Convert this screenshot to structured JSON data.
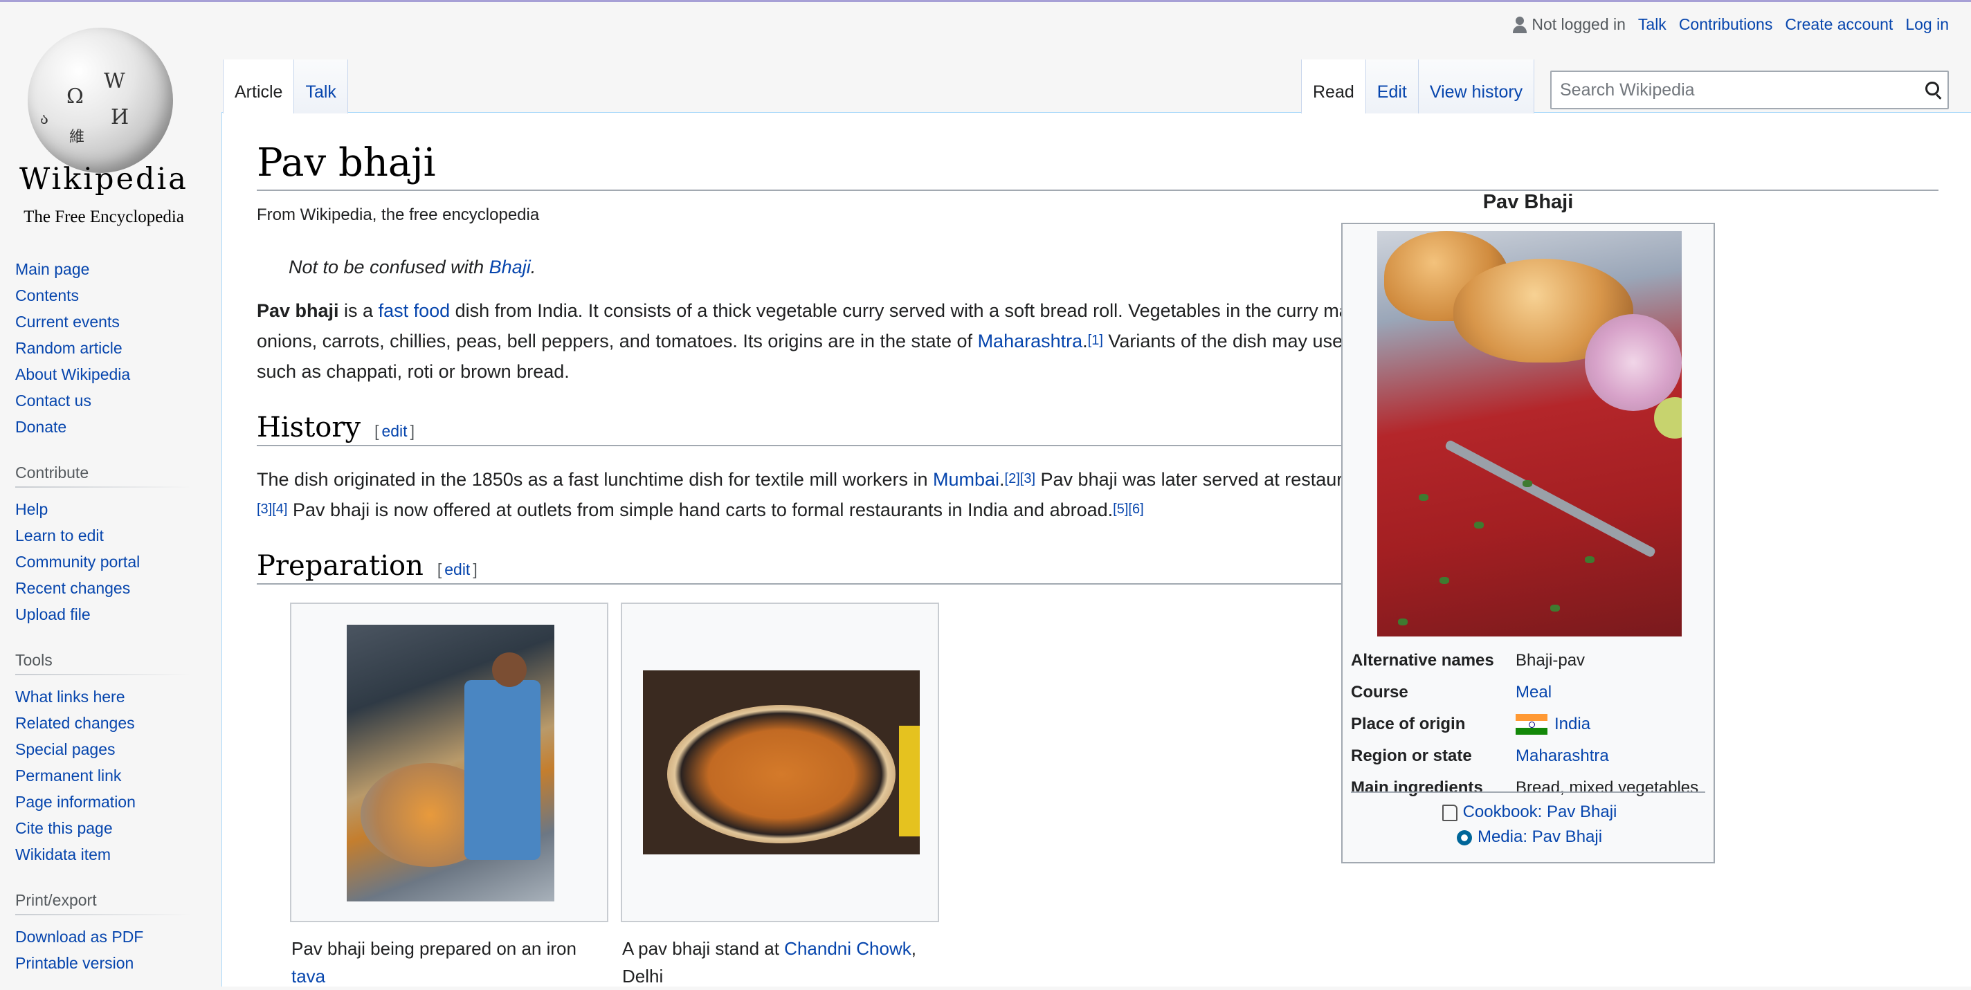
{
  "logo": {
    "wordmark": "Wikipedia",
    "tagline": "The Free Encyclopedia"
  },
  "sidebar": {
    "navigation": [
      "Main page",
      "Contents",
      "Current events",
      "Random article",
      "About Wikipedia",
      "Contact us",
      "Donate"
    ],
    "contribute_heading": "Contribute",
    "contribute": [
      "Help",
      "Learn to edit",
      "Community portal",
      "Recent changes",
      "Upload file"
    ],
    "tools_heading": "Tools",
    "tools": [
      "What links here",
      "Related changes",
      "Special pages",
      "Permanent link",
      "Page information",
      "Cite this page",
      "Wikidata item"
    ],
    "print_heading": "Print/export",
    "print": [
      "Download as PDF",
      "Printable version"
    ]
  },
  "personal": {
    "status": "Not logged in",
    "talk": "Talk",
    "contributions": "Contributions",
    "create_account": "Create account",
    "login": "Log in"
  },
  "tabs": {
    "article": "Article",
    "talk": "Talk",
    "read": "Read",
    "edit": "Edit",
    "history": "View history"
  },
  "search": {
    "placeholder": "Search Wikipedia"
  },
  "article": {
    "title": "Pav bhaji",
    "site_sub": "From Wikipedia, the free encyclopedia",
    "hatnote_prefix": "Not to be confused with ",
    "hatnote_link": "Bhaji",
    "hatnote_suffix": ".",
    "intro": {
      "bold": "Pav bhaji",
      "t1": " is a ",
      "link1": "fast food",
      "t2": " dish from India. It consists of a thick vegetable curry served with a soft bread roll. Vegetables in the curry may include potatoes, onions, carrots, chillies, peas, bell peppers, and tomatoes. Its origins are in the state of ",
      "link2": "Maharashtra",
      "t3": ".",
      "ref1": "[1]",
      "t4": " Variants of the dish may use other bread varieties such as chappati, roti or brown bread."
    },
    "history": {
      "heading": "History",
      "edit_open": "[",
      "edit": "edit",
      "edit_close": "]",
      "t1": "The dish originated in the 1850s as a fast lunchtime dish for textile mill workers in ",
      "link1": "Mumbai",
      "t2": ".",
      "ref1": "[2]",
      "ref2": "[3]",
      "t3": " Pav bhaji was later served at restaurants throughout the city.",
      "ref3": "[3]",
      "ref4": "[4]",
      "t4": " Pav bhaji is now offered at outlets from simple hand carts to formal restaurants in India and abroad.",
      "ref5": "[5]",
      "ref6": "[6]"
    },
    "preparation": {
      "heading": "Preparation",
      "edit_open": "[",
      "edit": "edit",
      "edit_close": "]"
    },
    "gallery": [
      {
        "caption_text": "Pav bhaji being prepared on an iron ",
        "caption_link": "tava",
        "caption_end": ""
      },
      {
        "caption_text": "A pav bhaji stand at ",
        "caption_link": "Chandni Chowk",
        "caption_end": ", Delhi"
      }
    ]
  },
  "infobox": {
    "title": "Pav Bhaji",
    "rows": [
      {
        "label": "Alternative names",
        "value": "Bhaji-pav"
      },
      {
        "label": "Course",
        "value": "Meal"
      },
      {
        "label": "Place of origin",
        "value": "India"
      },
      {
        "label": "Region or state",
        "value": "Maharashtra"
      },
      {
        "label": "Main ingredients",
        "value": "Bread, mixed vegetables"
      }
    ],
    "cookbook": "Cookbook: Pav Bhaji",
    "media": "Media: Pav Bhaji"
  },
  "colors": {
    "link": "#0645ad",
    "text": "#202122",
    "border": "#a2a9b1",
    "sidebar_bg": "#f6f6f6"
  }
}
